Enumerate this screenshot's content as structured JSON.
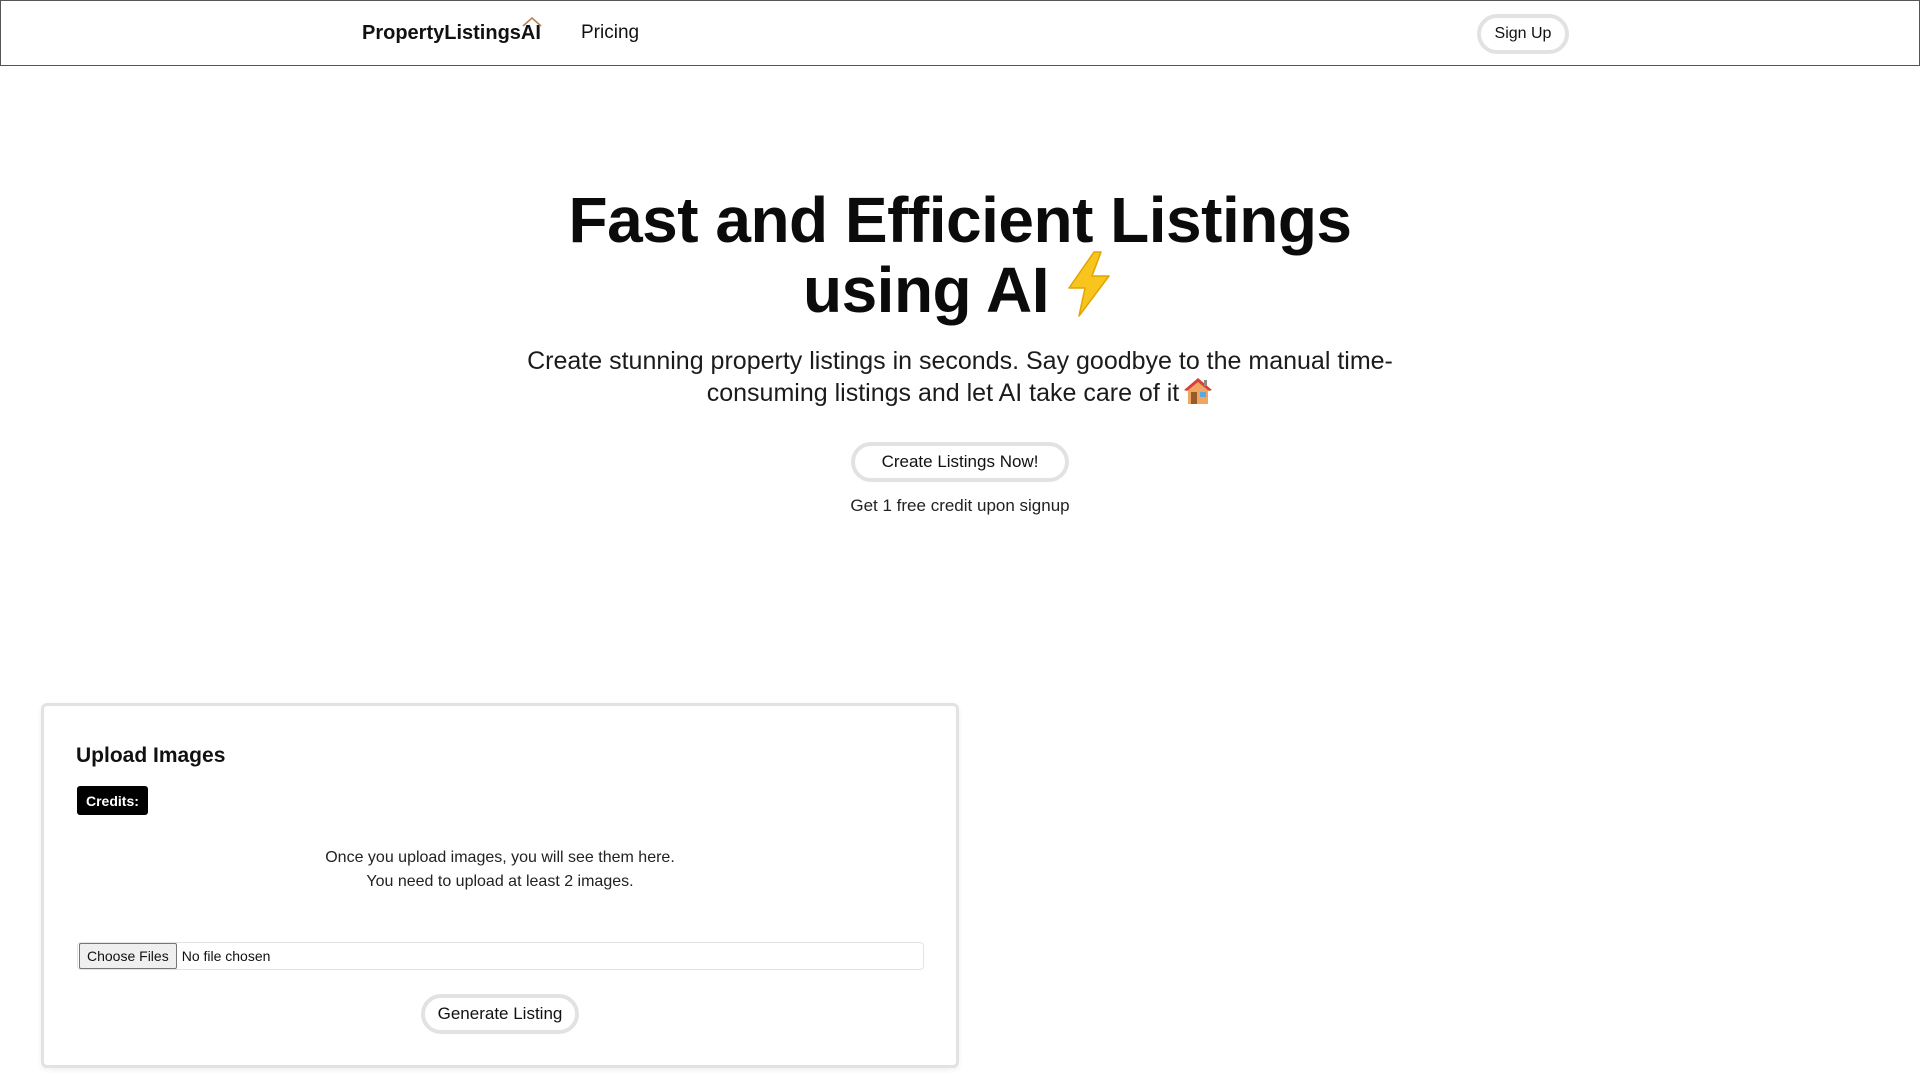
{
  "navbar": {
    "brand": "PropertyListingsAI",
    "links": [
      {
        "label": "Pricing"
      }
    ],
    "signup_label": "Sign Up"
  },
  "hero": {
    "title_line1": "Fast and Efficient Listings",
    "title_line2": "using AI",
    "title_icon": "lightning-bolt-icon",
    "subtitle_line1": "Create stunning property listings in seconds. Say goodbye to the manual time-",
    "subtitle_line2": "consuming listings and let AI take care of it",
    "subtitle_icon": "house-icon",
    "cta_label": "Create Listings Now!",
    "cta_note": "Get 1 free credit upon signup"
  },
  "upload_card": {
    "title": "Upload Images",
    "credits_label": "Credits:",
    "message_line1": "Once you upload images, you will see them here.",
    "message_line2": "You need to upload at least 2 images.",
    "choose_files_label": "Choose Files",
    "file_status": "No file chosen",
    "generate_label": "Generate Listing"
  },
  "colors": {
    "background": "#ffffff",
    "text": "#111111",
    "button_border": "#e2e2e2",
    "badge_background": "#000000",
    "bolt": "#f7c51e",
    "roof_accent": "#b4835a"
  }
}
